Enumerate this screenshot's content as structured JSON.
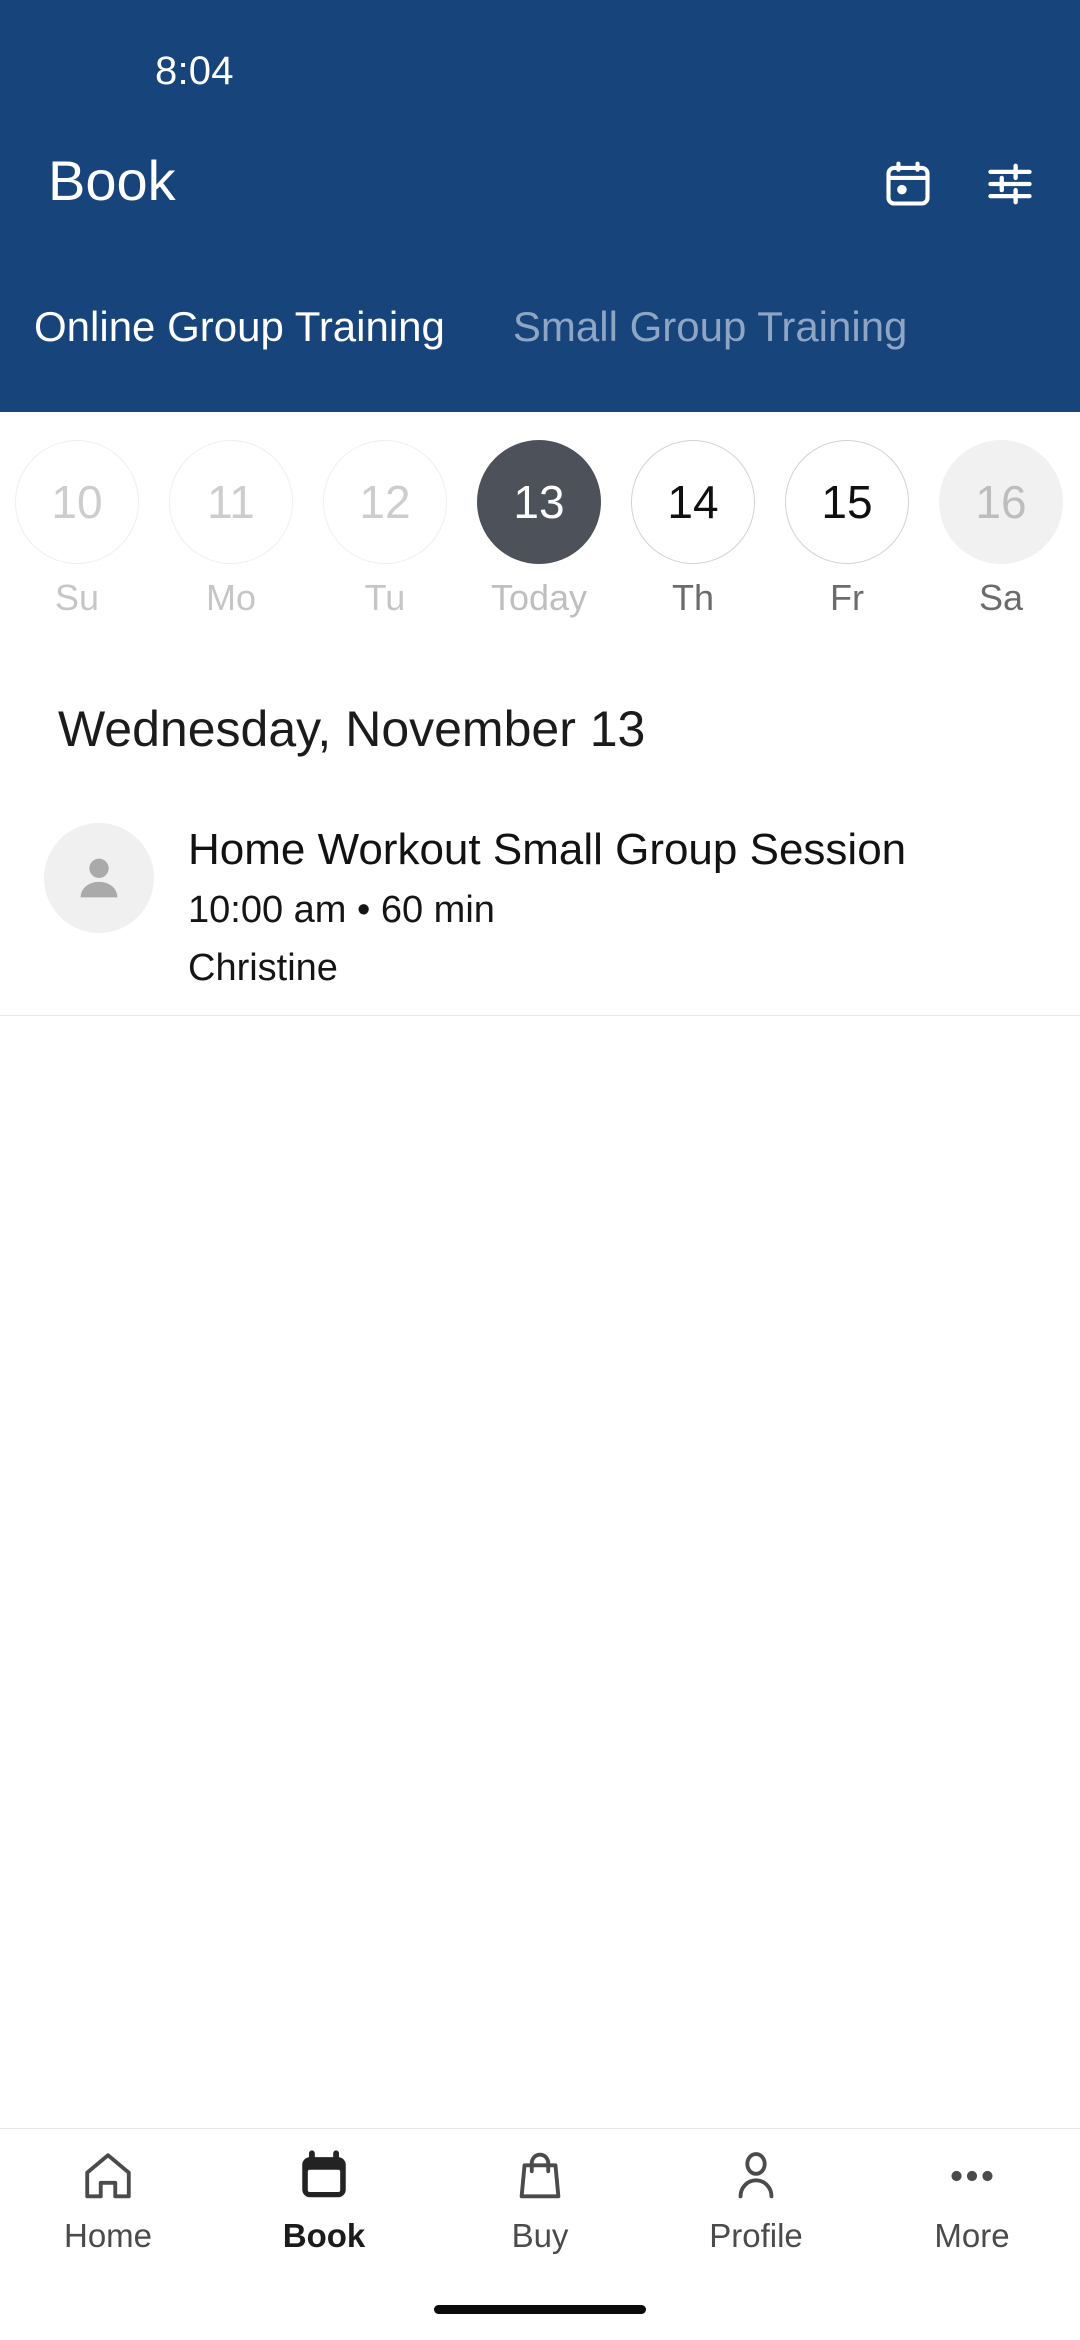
{
  "theme": {
    "header_blue": "#17447A",
    "today_circle": "#4D5159",
    "tab_inactive": "#8EA6C4",
    "divider": "#EAEAEA",
    "avatar_bg": "#F0F0F0"
  },
  "status_bar": {
    "time": "8:04"
  },
  "header": {
    "title": "Book",
    "actions": [
      {
        "name": "calendar-icon",
        "label": "Calendar"
      },
      {
        "name": "tune-icon",
        "label": "Filters"
      }
    ]
  },
  "tabs": [
    {
      "label": "Online Group Training",
      "active": true
    },
    {
      "label": "Small Group Training",
      "active": false
    }
  ],
  "date_strip": [
    {
      "day_number": "10",
      "day_label": "Su",
      "state": "past"
    },
    {
      "day_number": "11",
      "day_label": "Mo",
      "state": "past"
    },
    {
      "day_number": "12",
      "day_label": "Tu",
      "state": "past"
    },
    {
      "day_number": "13",
      "day_label": "Today",
      "state": "today"
    },
    {
      "day_number": "14",
      "day_label": "Th",
      "state": "future"
    },
    {
      "day_number": "15",
      "day_label": "Fr",
      "state": "future"
    },
    {
      "day_number": "16",
      "day_label": "Sa",
      "state": "disabled"
    }
  ],
  "main": {
    "day_heading": "Wednesday, November 13",
    "sessions": [
      {
        "title": "Home Workout Small Group Session",
        "meta": "10:00 am • 60 min",
        "trainer": "Christine",
        "avatar_icon": "person-icon"
      }
    ]
  },
  "bottom_nav": [
    {
      "label": "Home",
      "icon": "home-icon",
      "active": false
    },
    {
      "label": "Book",
      "icon": "calendar-icon",
      "active": true
    },
    {
      "label": "Buy",
      "icon": "bag-icon",
      "active": false
    },
    {
      "label": "Profile",
      "icon": "person-icon",
      "active": false
    },
    {
      "label": "More",
      "icon": "dots-icon",
      "active": false
    }
  ]
}
